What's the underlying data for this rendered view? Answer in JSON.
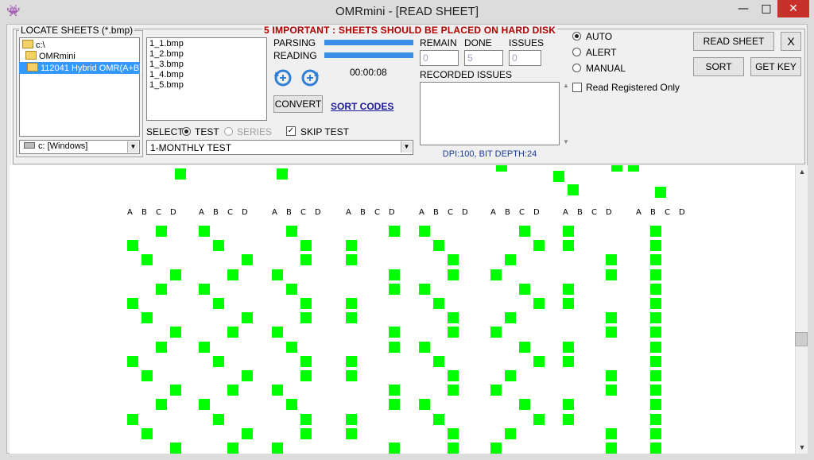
{
  "window": {
    "title": "OMRmini - [READ SHEET]",
    "app_icon": "👾",
    "minimize": "—",
    "maximize": "□",
    "close": "✕"
  },
  "locate": {
    "label": "LOCATE SHEETS (*.bmp)",
    "tree": [
      "c:\\",
      "OMRmini",
      "112041 Hybrid OMR(A+B)"
    ],
    "drive": "c: [Windows]"
  },
  "important": "5 IMPORTANT : SHEETS SHOULD BE PLACED ON HARD DISK",
  "files": [
    "1_1.bmp",
    "1_2.bmp",
    "1_3.bmp",
    "1_4.bmp",
    "1_5.bmp"
  ],
  "progress": {
    "parsing_label": "PARSING",
    "reading_label": "READING",
    "parsing": 1.0,
    "reading": 1.0,
    "time": "00:00:08"
  },
  "actions": {
    "convert": "CONVERT",
    "sort_codes": "SORT CODES"
  },
  "counts": {
    "remain_label": "REMAIN",
    "done_label": "DONE",
    "issues_label": "ISSUES",
    "remain": "0",
    "done": "5",
    "issues": "0"
  },
  "recorded_issues_label": "RECORDED ISSUES",
  "dpi_text": "DPI:100, BIT DEPTH:24",
  "select": {
    "label": "SELECT",
    "test": "TEST",
    "series": "SERIES",
    "skip_test": "SKIP TEST",
    "test_type": "1-MONTHLY TEST"
  },
  "mode": {
    "auto": "AUTO",
    "alert": "ALERT",
    "manual": "MANUAL",
    "read_registered": "Read Registered Only"
  },
  "buttons": {
    "read_sheet": "READ SHEET",
    "close": "X",
    "sort": "SORT",
    "get_key": "GET KEY"
  },
  "sheet": {
    "header": [
      "A",
      "B",
      "C",
      "D"
    ]
  },
  "colors": {
    "mark": "#00ff00",
    "progress": "#3a8ee6",
    "warning": "#b00000",
    "link": "#1a1a9a"
  }
}
